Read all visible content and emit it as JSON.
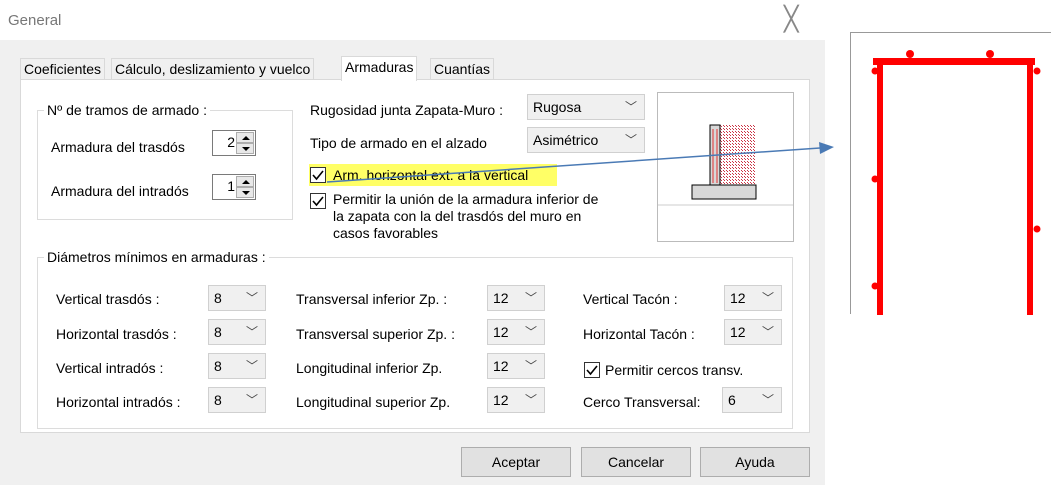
{
  "window": {
    "title": "General",
    "close_glyph": "╳"
  },
  "tabs": [
    "Coeficientes",
    "Cálculo, deslizamiento y vuelco",
    "Armaduras",
    "Cuantías"
  ],
  "tramos": {
    "title": "Nº de tramos de armado :",
    "trasdos_label": "Armadura del trasdós",
    "trasdos_value": "2",
    "intrados_label": "Armadura del intradós",
    "intrados_value": "1"
  },
  "options": {
    "rugosidad_label": "Rugosidad junta Zapata-Muro :",
    "rugosidad_value": "Rugosa",
    "tipo_label": "Tipo de armado en el alzado",
    "tipo_value": "Asimétrico",
    "arm_horizontal_label": "Arm. horizontal ext. a la vertical",
    "arm_horizontal_checked": true,
    "union_line1": "Permitir la unión de la armadura inferior de",
    "union_line2": "la zapata con la del trasdós del muro en",
    "union_line3": "casos favorables",
    "union_checked": true
  },
  "diametros": {
    "title": "Diámetros mínimos en armaduras :",
    "col1": [
      {
        "label": "Vertical trasdós :",
        "value": "8"
      },
      {
        "label": "Horizontal trasdós :",
        "value": "8"
      },
      {
        "label": "Vertical intradós :",
        "value": "8"
      },
      {
        "label": "Horizontal intradós :",
        "value": "8"
      }
    ],
    "col2": [
      {
        "label": "Transversal inferior Zp. :",
        "value": "12"
      },
      {
        "label": "Transversal superior Zp. :",
        "value": "12"
      },
      {
        "label": "Longitudinal inferior Zp.",
        "value": "12"
      },
      {
        "label": "Longitudinal superior Zp.",
        "value": "12"
      }
    ],
    "col3": [
      {
        "label": "Vertical Tacón :",
        "value": "12"
      },
      {
        "label": "Horizontal Tacón :",
        "value": "12"
      }
    ],
    "cercos_label": "Permitir cercos transv.",
    "cercos_checked": true,
    "cerco_transversal_label": "Cerco Transversal:",
    "cerco_transversal_value": "6"
  },
  "buttons": {
    "aceptar": "Aceptar",
    "cancelar": "Cancelar",
    "ayuda": "Ayuda"
  },
  "icons": {
    "dropdown": "chevron-down-icon",
    "spin_up": "spin-up-icon",
    "spin_down": "spin-down-icon",
    "check": "checkmark-icon"
  },
  "colors": {
    "highlight": "#ffff66",
    "rebar": "#ff0000",
    "arrow": "#4a7ab5",
    "hatch": "#cc3344"
  }
}
